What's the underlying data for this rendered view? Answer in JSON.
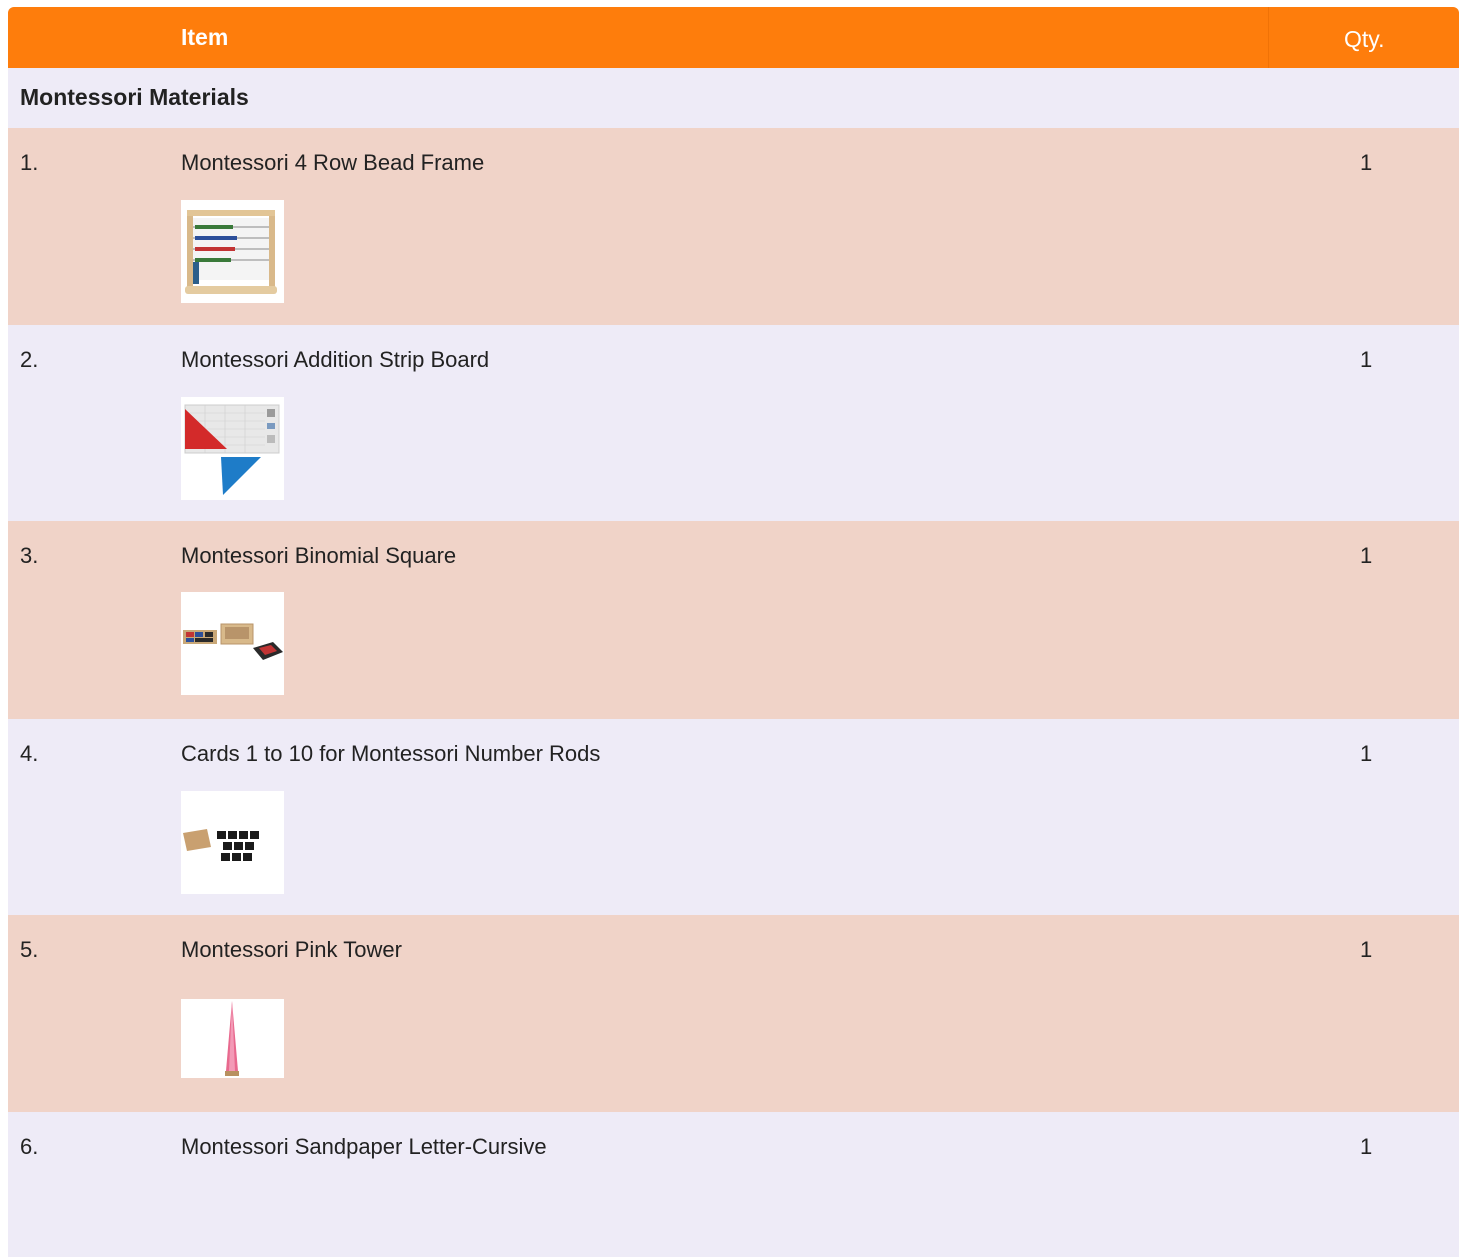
{
  "header": {
    "item_label": "Item",
    "qty_label": "Qty."
  },
  "category": {
    "label": "Montessori Materials"
  },
  "colors": {
    "header_bg": "#fe7d0c",
    "row_odd_bg": "#f0d3c8",
    "row_even_bg": "#eeebf7"
  },
  "rows": [
    {
      "num": "1.",
      "name": "Montessori 4 Row Bead Frame",
      "qty": "1",
      "image_icon": "bead-frame-image"
    },
    {
      "num": "2.",
      "name": "Montessori Addition Strip Board",
      "qty": "1",
      "image_icon": "addition-strip-board-image"
    },
    {
      "num": "3.",
      "name": "Montessori Binomial Square",
      "qty": "1",
      "image_icon": "binomial-square-image"
    },
    {
      "num": "4.",
      "name": "Cards 1 to 10 for Montessori Number Rods",
      "qty": "1",
      "image_icon": "number-cards-image"
    },
    {
      "num": "5.",
      "name": "Montessori Pink Tower",
      "qty": "1",
      "image_icon": "pink-tower-image"
    },
    {
      "num": "6.",
      "name": "Montessori Sandpaper Letter-Cursive",
      "qty": "1",
      "image_icon": ""
    }
  ]
}
